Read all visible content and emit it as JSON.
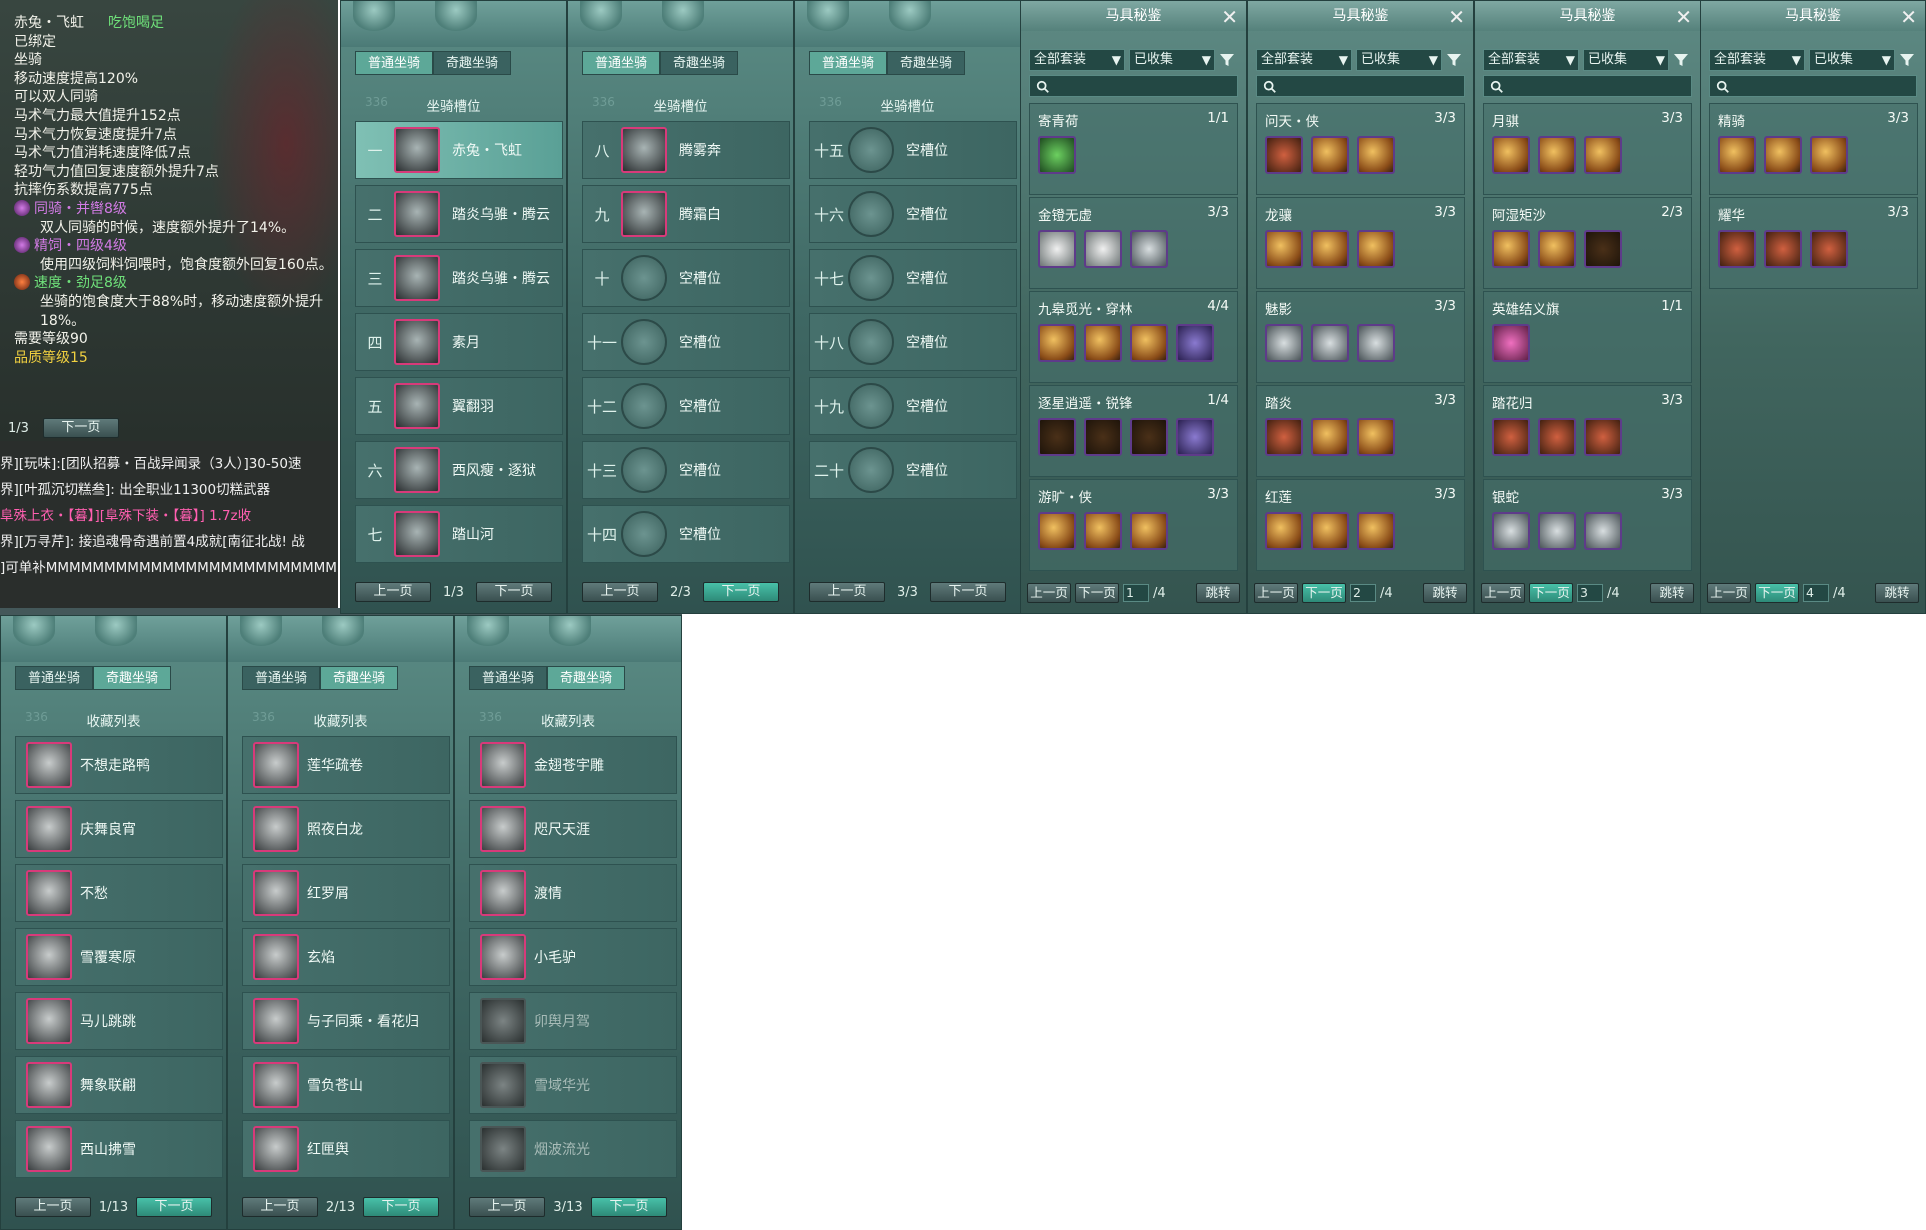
{
  "tooltip": {
    "lines": [
      {
        "text": "赤兔・飞虹",
        "extra": "吃饱喝足",
        "cls": "pink"
      },
      {
        "text": "已绑定",
        "extra": "",
        "cls": "white"
      },
      {
        "text": "坐骑",
        "extra": "",
        "cls": "white"
      },
      {
        "text": "移动速度提高120%",
        "extra": "",
        "cls": "white"
      },
      {
        "text": "可以双人同骑",
        "extra": "",
        "cls": "white"
      },
      {
        "text": "马术气力最大值提升152点",
        "extra": "",
        "cls": "white"
      },
      {
        "text": "马术气力恢复速度提升7点",
        "extra": "",
        "cls": "white"
      },
      {
        "text": "马术气力值消耗速度降低7点",
        "extra": "",
        "cls": "white"
      },
      {
        "text": "轻功气力值回复速度额外提升7点",
        "extra": "",
        "cls": "white"
      },
      {
        "text": "抗摔伤系数提高775点",
        "extra": "",
        "cls": "white"
      },
      {
        "text": "同骑・并辔8级",
        "extra": "",
        "cls": "purple"
      },
      {
        "text": "双人同骑的时候，速度额外提升了14%。",
        "extra": "",
        "cls": "white"
      },
      {
        "text": "精饲・四级4级",
        "extra": "",
        "cls": "purple"
      },
      {
        "text": "使用四级饲料饲喂时，饱食度额外回复160点。",
        "extra": "",
        "cls": "white"
      },
      {
        "text": "速度・劲足8级",
        "extra": "",
        "cls": "green"
      },
      {
        "text": "坐骑的饱食度大于88%时，移动速度额外提升18%。",
        "extra": "",
        "cls": "white"
      },
      {
        "text": "需要等级90",
        "extra": "",
        "cls": "white"
      },
      {
        "text": "品质等级15",
        "extra": "",
        "cls": "yellow"
      }
    ],
    "page": "1/3",
    "next_label": "下一页"
  },
  "chat": [
    {
      "text": "界][玩味]:[团队招募・百战异闻录（3人）]30-50速",
      "pink": false
    },
    {
      "text": "界][叶孤沉切糕叁]: 出全职业11300切糕武器",
      "pink": false
    },
    {
      "text": "阜殊上衣・【暮】][阜殊下装・【暮】] 1.7z收",
      "pink": true
    },
    {
      "text": "界][万寻芹]: 接追魂骨奇遇前置4成就[南征北战! 战",
      "pink": false
    },
    {
      "text": "]可单补MMMMMMMMMMMMMMMMMMMMMMMMMMM",
      "pink": false
    }
  ],
  "slot_panels": [
    {
      "tabs": [
        "普通坐骑",
        "奇趣坐骑"
      ],
      "title": "坐骑槽位",
      "faded": "336",
      "page": "1/3",
      "prev": "上一页",
      "next": "下一页",
      "slots": [
        {
          "num": "一",
          "name": "赤兔・飞虹"
        },
        {
          "num": "二",
          "name": "踏炎乌骓・腾云"
        },
        {
          "num": "三",
          "name": "踏炎乌骓・腾云"
        },
        {
          "num": "四",
          "name": "素月"
        },
        {
          "num": "五",
          "name": "翼翻羽"
        },
        {
          "num": "六",
          "name": "西风瘦・逐狱"
        },
        {
          "num": "七",
          "name": "踏山河"
        }
      ]
    },
    {
      "tabs": [
        "普通坐骑",
        "奇趣坐骑"
      ],
      "title": "坐骑槽位",
      "faded": "336",
      "page": "2/3",
      "prev": "上一页",
      "next": "下一页",
      "slots": [
        {
          "num": "八",
          "name": "腾雾奔"
        },
        {
          "num": "九",
          "name": "腾霜白"
        },
        {
          "num": "十",
          "name": "空槽位"
        },
        {
          "num": "十一",
          "name": "空槽位"
        },
        {
          "num": "十二",
          "name": "空槽位"
        },
        {
          "num": "十三",
          "name": "空槽位"
        },
        {
          "num": "十四",
          "name": "空槽位"
        }
      ]
    },
    {
      "tabs": [
        "普通坐骑",
        "奇趣坐骑"
      ],
      "title": "坐骑槽位",
      "faded": "336",
      "page": "3/3",
      "prev": "上一页",
      "next": "下一页",
      "slots": [
        {
          "num": "十五",
          "name": "空槽位"
        },
        {
          "num": "十六",
          "name": "空槽位"
        },
        {
          "num": "十七",
          "name": "空槽位"
        },
        {
          "num": "十八",
          "name": "空槽位"
        },
        {
          "num": "十九",
          "name": "空槽位"
        },
        {
          "num": "二十",
          "name": "空槽位"
        }
      ]
    }
  ],
  "equip_panels": [
    {
      "title": "马具秘鉴",
      "filter1": "全部套装",
      "filter2": "已收集",
      "page": "1",
      "total": "/4",
      "prev": "上一页",
      "next": "下一页",
      "jump": "跳转",
      "groups": [
        {
          "name": "寄青荷",
          "count": "1/1",
          "items": [
            "green"
          ]
        },
        {
          "name": "金镫无虚",
          "count": "3/3",
          "items": [
            "white",
            "white",
            "silver"
          ]
        },
        {
          "name": "九皋觅光・穿林",
          "count": "4/4",
          "items": [
            "gold",
            "gold",
            "gold",
            "blue"
          ]
        },
        {
          "name": "逐星逍遥・锐锋",
          "count": "1/4",
          "items": [
            "dark",
            "dark",
            "dark",
            "blue"
          ]
        },
        {
          "name": "游旷・侠",
          "count": "3/3",
          "items": [
            "gold",
            "gold",
            "gold"
          ]
        }
      ]
    },
    {
      "title": "马具秘鉴",
      "filter1": "全部套装",
      "filter2": "已收集",
      "page": "2",
      "total": "/4",
      "prev": "上一页",
      "next": "下一页",
      "jump": "跳转",
      "groups": [
        {
          "name": "问天・侠",
          "count": "3/3",
          "items": [
            "red",
            "gold",
            "gold"
          ]
        },
        {
          "name": "龙骧",
          "count": "3/3",
          "items": [
            "gold",
            "gold",
            "gold"
          ]
        },
        {
          "name": "魅影",
          "count": "3/3",
          "items": [
            "silver",
            "silver",
            "silver"
          ]
        },
        {
          "name": "踏炎",
          "count": "3/3",
          "items": [
            "red",
            "gold",
            "gold"
          ]
        },
        {
          "name": "红莲",
          "count": "3/3",
          "items": [
            "gold",
            "gold",
            "gold"
          ]
        }
      ]
    },
    {
      "title": "马具秘鉴",
      "filter1": "全部套装",
      "filter2": "已收集",
      "page": "3",
      "total": "/4",
      "prev": "上一页",
      "next": "下一页",
      "jump": "跳转",
      "groups": [
        {
          "name": "月骐",
          "count": "3/3",
          "items": [
            "gold",
            "gold",
            "gold"
          ]
        },
        {
          "name": "阿湿矩沙",
          "count": "2/3",
          "items": [
            "gold",
            "gold",
            "dark"
          ]
        },
        {
          "name": "英雄结义旗",
          "count": "1/1",
          "items": [
            "pink"
          ]
        },
        {
          "name": "踏花归",
          "count": "3/3",
          "items": [
            "red",
            "red",
            "red"
          ]
        },
        {
          "name": "银蛇",
          "count": "3/3",
          "items": [
            "silver",
            "silver",
            "silver"
          ]
        }
      ]
    },
    {
      "title": "马具秘鉴",
      "filter1": "全部套装",
      "filter2": "已收集",
      "page": "4",
      "total": "/4",
      "prev": "上一页",
      "next": "下一页",
      "jump": "跳转",
      "groups": [
        {
          "name": "精骑",
          "count": "3/3",
          "items": [
            "gold",
            "gold",
            "gold"
          ]
        },
        {
          "name": "耀华",
          "count": "3/3",
          "items": [
            "red",
            "red",
            "red"
          ]
        }
      ]
    }
  ],
  "fav_panels": [
    {
      "tabs": [
        "普通坐骑",
        "奇趣坐骑"
      ],
      "title": "收藏列表",
      "faded": "336",
      "page": "1/13",
      "prev": "上一页",
      "next": "下一页",
      "items": [
        {
          "name": "不想走路鸭",
          "dim": false
        },
        {
          "name": "庆舞良宵",
          "dim": false
        },
        {
          "name": "不愁",
          "dim": false
        },
        {
          "name": "雪覆寒原",
          "dim": false
        },
        {
          "name": "马儿跳跳",
          "dim": false
        },
        {
          "name": "舞象联翩",
          "dim": false
        },
        {
          "name": "西山拂雪",
          "dim": false
        }
      ]
    },
    {
      "tabs": [
        "普通坐骑",
        "奇趣坐骑"
      ],
      "title": "收藏列表",
      "faded": "336",
      "page": "2/13",
      "prev": "上一页",
      "next": "下一页",
      "items": [
        {
          "name": "莲华疏卷",
          "dim": false
        },
        {
          "name": "照夜白龙",
          "dim": false
        },
        {
          "name": "红罗屑",
          "dim": false
        },
        {
          "name": "玄焰",
          "dim": false
        },
        {
          "name": "与子同乘・看花归",
          "dim": false
        },
        {
          "name": "雪负苍山",
          "dim": false
        },
        {
          "name": "红匣舆",
          "dim": false
        }
      ]
    },
    {
      "tabs": [
        "普通坐骑",
        "奇趣坐骑"
      ],
      "title": "收藏列表",
      "faded": "336",
      "page": "3/13",
      "prev": "上一页",
      "next": "下一页",
      "items": [
        {
          "name": "金翅苍宇雕",
          "dim": false
        },
        {
          "name": "咫尺天涯",
          "dim": false
        },
        {
          "name": "渡情",
          "dim": false
        },
        {
          "name": "小毛驴",
          "dim": false
        },
        {
          "name": "卯舆月驾",
          "dim": true
        },
        {
          "name": "雪域华光",
          "dim": true
        },
        {
          "name": "烟波流光",
          "dim": true
        }
      ]
    }
  ]
}
